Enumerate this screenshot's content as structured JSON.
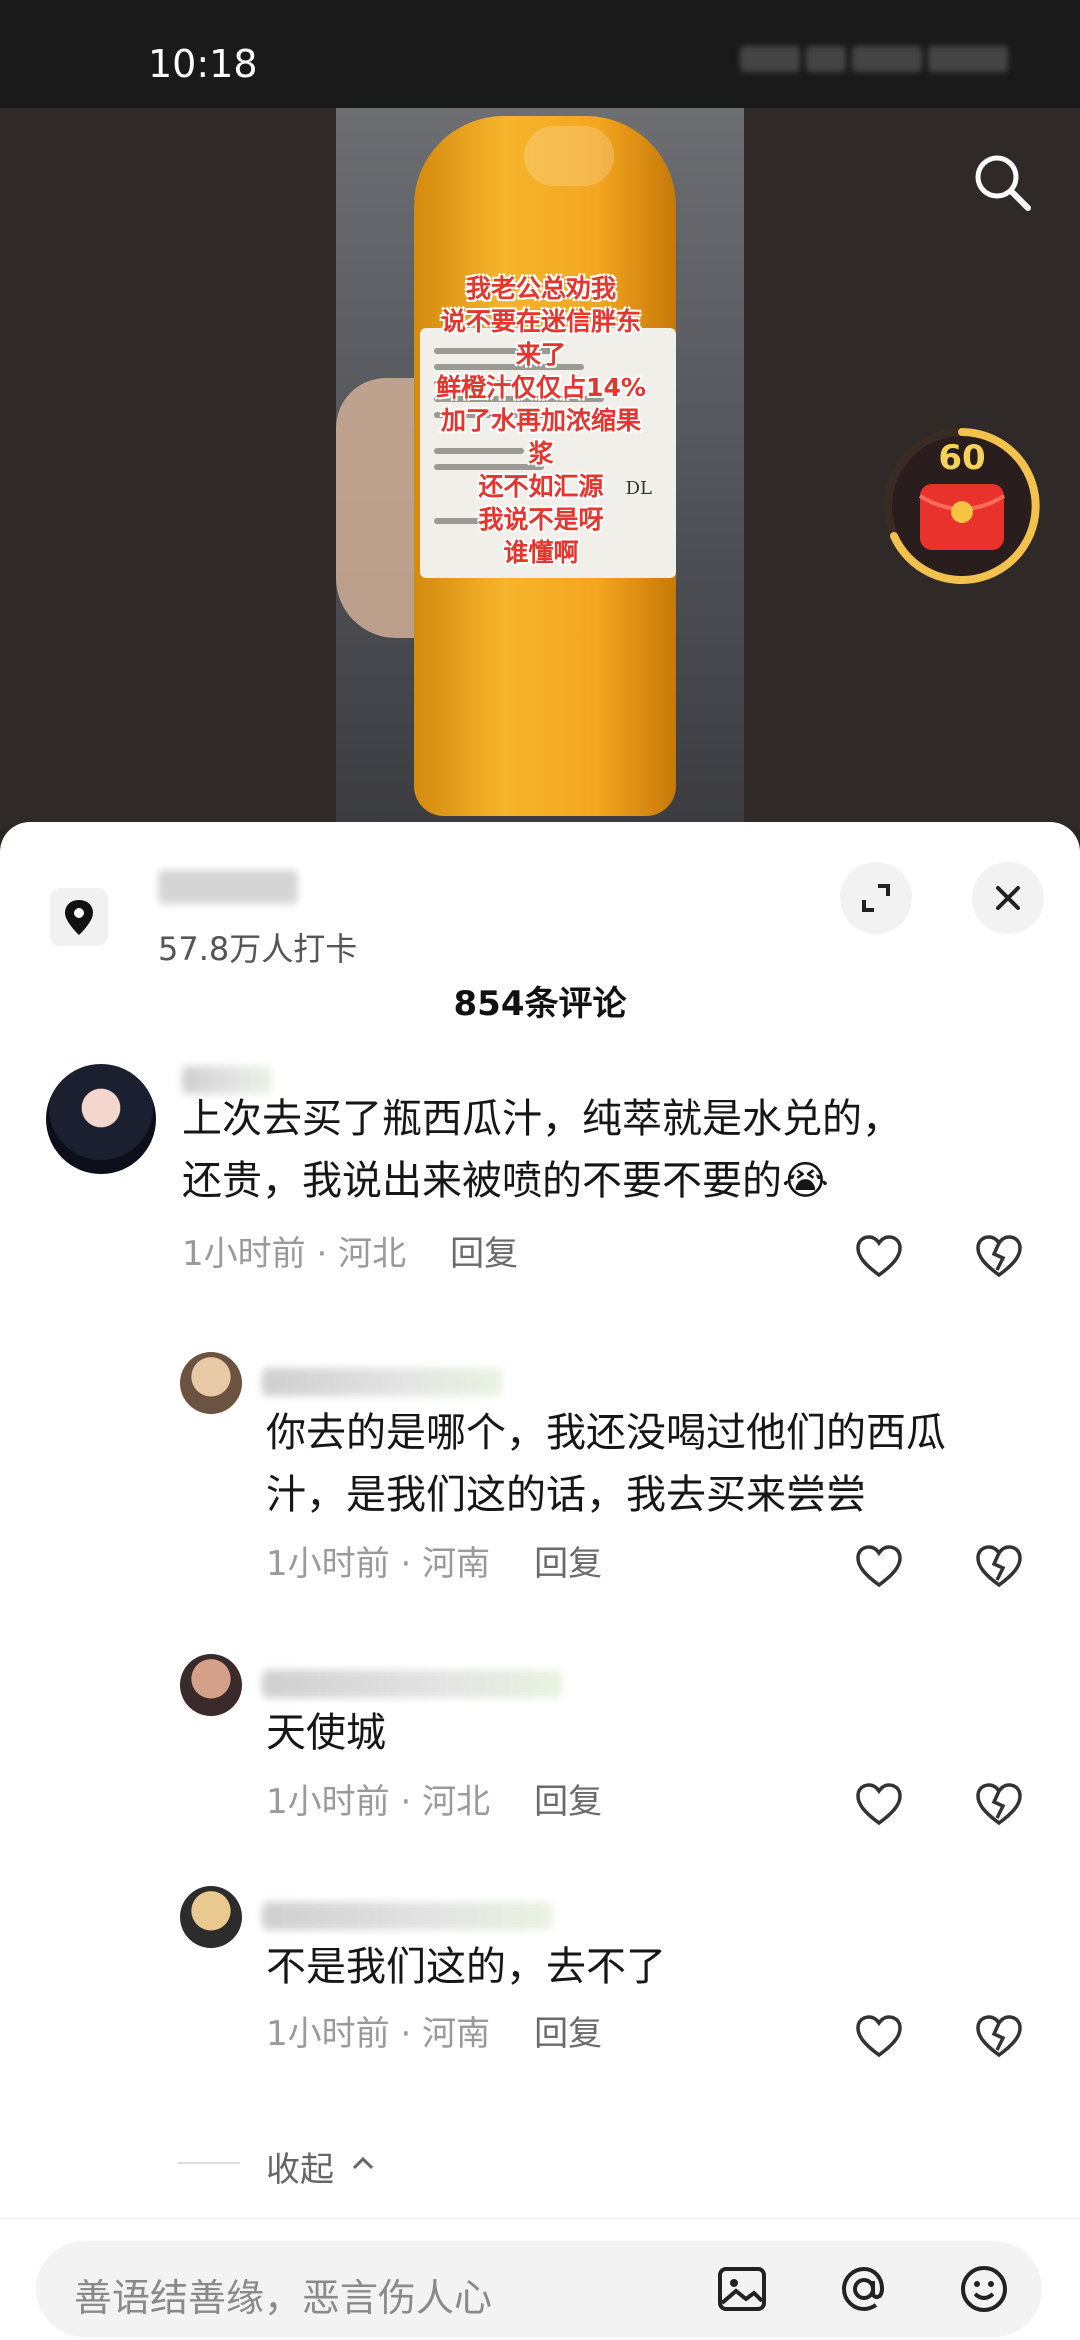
{
  "status_bar": {
    "time": "10:18"
  },
  "video": {
    "caption_lines": [
      "我老公总劝我",
      "说不要在迷信胖东",
      "来了",
      "鲜橙汁仅仅占14%",
      "加了水再加浓缩果",
      "浆",
      "还不如汇源",
      "我说不是呀",
      "谁懂啊"
    ],
    "bottle_label_text": "DL",
    "red_packet_count": "60"
  },
  "sheet": {
    "location_checkins": "57.8万人打卡",
    "comment_count": "854条评论",
    "comments": [
      {
        "text_line1": "上次去买了瓶西瓜汁，纯萃就是水兑的，",
        "text_line2": "还贵，我说出来被喷的不要不要的",
        "emoji": "😭",
        "time": "1小时前",
        "region": "河北",
        "reply_label": "回复"
      },
      {
        "text_line1": "你去的是哪个，我还没喝过他们的西瓜",
        "text_line2": "汁，是我们这的话，我去买来尝尝",
        "time": "1小时前",
        "region": "河南",
        "reply_label": "回复"
      },
      {
        "text_line1": "天使城",
        "time": "1小时前",
        "region": "河北",
        "reply_label": "回复"
      },
      {
        "text_line1": "不是我们这的，去不了",
        "time": "1小时前",
        "region": "河南",
        "reply_label": "回复"
      }
    ],
    "collapse_label": "收起",
    "input_placeholder": "善语结善缘，恶言伤人心"
  },
  "icons": {
    "search": "search-icon",
    "location": "location-pin-icon",
    "expand": "expand-icon",
    "close": "close-icon",
    "like": "heart-icon",
    "dislike": "broken-heart-icon",
    "image": "image-icon",
    "mention": "at-icon",
    "emoji": "emoji-icon"
  }
}
